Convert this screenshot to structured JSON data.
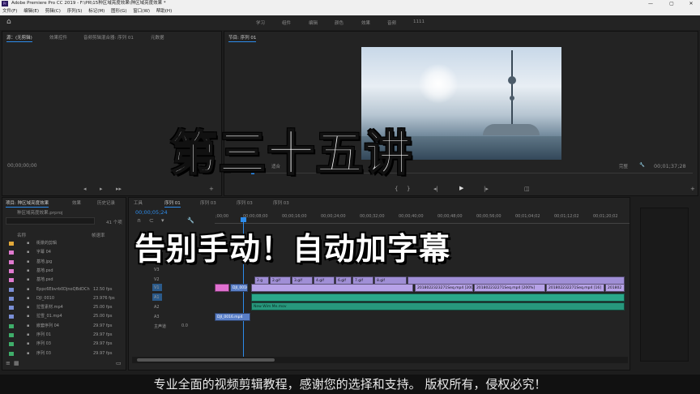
{
  "window": {
    "title": "Adobe Premiere Pro CC 2019 - F:\\PR\\15种区域亮度效果\\种区域亮度效果 *",
    "logo": "Pr",
    "controls": [
      "—",
      "▢",
      "✕"
    ]
  },
  "menu": [
    "文件(F)",
    "编辑(E)",
    "剪辑(C)",
    "序列(S)",
    "标记(M)",
    "图形(G)",
    "窗口(W)",
    "帮助(H)"
  ],
  "workspaces": [
    "学习",
    "组件",
    "编辑",
    "颜色",
    "效果",
    "音频",
    "1111"
  ],
  "source_panel": {
    "tabs": [
      "源：(无剪辑)",
      "效果控件",
      "音频剪辑混合器: 序列 01",
      "元数据"
    ],
    "timecode": "00;00;00;00"
  },
  "program_panel": {
    "tab": "节目: 序列 01",
    "timecode": "00;00;05;24",
    "fit": "适合",
    "quality": "完整",
    "duration": "00;01;37;28"
  },
  "overlay": {
    "title": "第三十五讲",
    "subtitle": "告别手动！自动加字幕",
    "caption": "专业全面的视频剪辑教程，感谢您的选择和支持。 版权所有，侵权必究！"
  },
  "project_panel": {
    "tabs": [
      "项目: 种区域亮度效果",
      "效果",
      "历史记录"
    ],
    "search_path": "种区域亮度效果.prproj",
    "count": "41 个项",
    "columns": [
      "名称",
      "帧速率"
    ],
    "items": [
      {
        "name": "街景的剪辑",
        "fps": "",
        "color": "#e3a93a"
      },
      {
        "name": "字幕 04",
        "fps": "",
        "color": "#e07ad0"
      },
      {
        "name": "基地.jpg",
        "fps": "",
        "color": "#e07ad0"
      },
      {
        "name": "基地.psd",
        "fps": "",
        "color": "#e07ad0"
      },
      {
        "name": "基地.psd",
        "fps": "",
        "color": "#e07ad0"
      },
      {
        "name": "Eppc6Ebvrb0DjnoQBdDCh",
        "fps": "12.50 fps",
        "color": "#7a8fd6"
      },
      {
        "name": "DJI_0010",
        "fps": "23.976 fps",
        "color": "#7a8fd6"
      },
      {
        "name": "拉雪素材.mp4",
        "fps": "25.00 fps",
        "color": "#7a8fd6"
      },
      {
        "name": "拉雪_01.mp4",
        "fps": "25.00 fps",
        "color": "#7a8fd6"
      },
      {
        "name": "嵌套序列 04",
        "fps": "29.97 fps",
        "color": "#3fae6a"
      },
      {
        "name": "序列 01",
        "fps": "29.97 fps",
        "color": "#3fae6a"
      },
      {
        "name": "序列 03",
        "fps": "29.97 fps",
        "color": "#3fae6a"
      },
      {
        "name": "序列 03",
        "fps": "29.97 fps",
        "color": "#3fae6a"
      }
    ]
  },
  "timeline": {
    "tabs": [
      "工具",
      "序列 01",
      "序列 03",
      "序列 03",
      "序列 03"
    ],
    "timecode": "00;00;05;24",
    "ruler": [
      ";00;00",
      "00;00;08;00",
      "00;00;16;00",
      "00;00;24;00",
      "00;00;32;00",
      "00;00;40;00",
      "00;00;48;00",
      "00;00;56;00",
      "00;01;04;02",
      "00;01;12;02",
      "00;01;20;02"
    ],
    "tracks": [
      "V3",
      "V2",
      "V1",
      "A1",
      "A2",
      "A3",
      "主声道"
    ],
    "master_value": "0.0",
    "clips_v2": [
      "2.g",
      "2.gif",
      "3.gif",
      "4.gif",
      "6.gif",
      "7.gif",
      "8.gif"
    ],
    "clips_v1": [
      "2018022323271Seq.mp4 [200%]",
      "201802232271Seq.mp4 [200%]",
      "201802232271Seq.mp4 [16]",
      "201802"
    ],
    "clip_audio": "New Wim Me.mov",
    "clip_extra": "DJI_0016.mp4"
  }
}
